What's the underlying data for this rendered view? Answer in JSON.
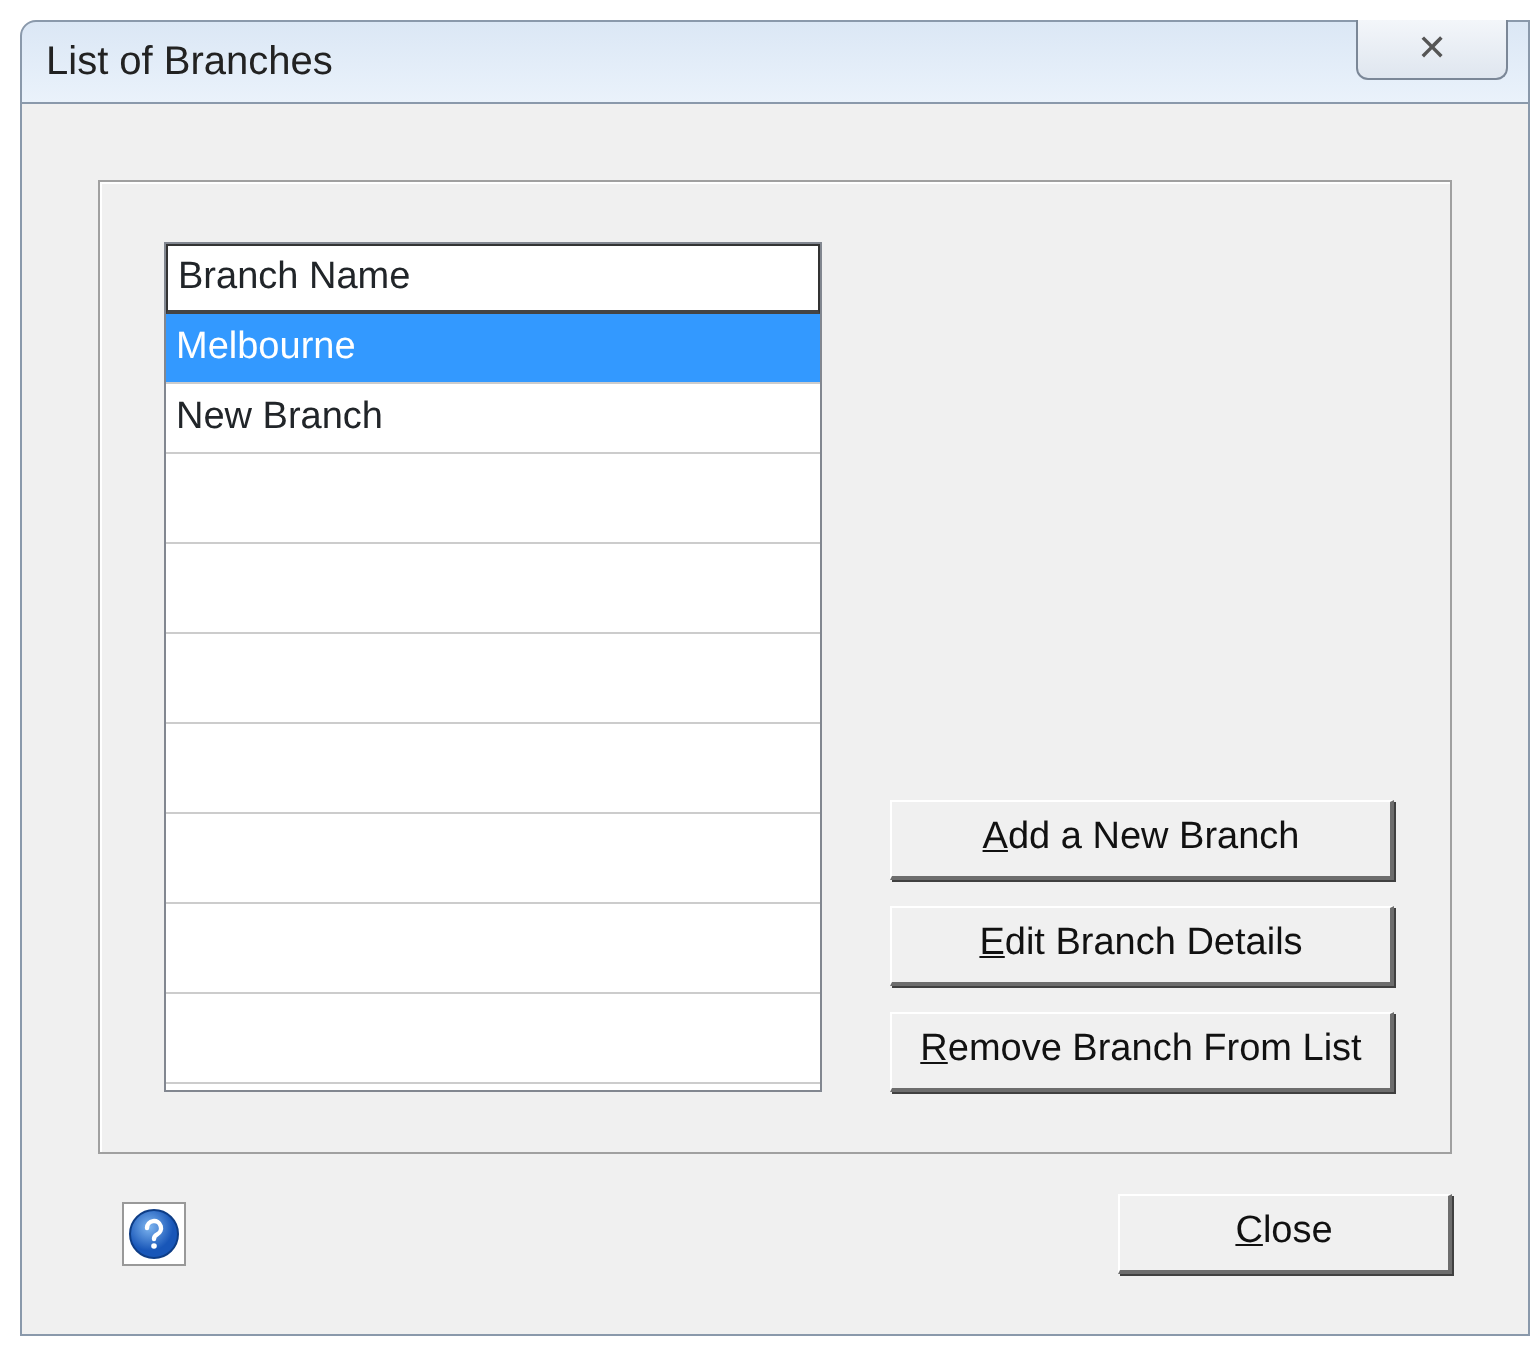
{
  "window": {
    "title": "List of Branches",
    "close_glyph": "✕"
  },
  "table": {
    "columns": [
      "Branch Name"
    ],
    "rows": [
      {
        "cells": [
          "Melbourne"
        ],
        "selected": true
      },
      {
        "cells": [
          "New Branch"
        ],
        "selected": false
      }
    ]
  },
  "actions": [
    {
      "underlined": "A",
      "rest": "dd a New Branch"
    },
    {
      "underlined": "E",
      "rest": "dit Branch Details"
    },
    {
      "underlined": "R",
      "rest": "emove Branch From List"
    }
  ],
  "footer": {
    "close": {
      "underlined": "C",
      "rest": "lose"
    }
  }
}
